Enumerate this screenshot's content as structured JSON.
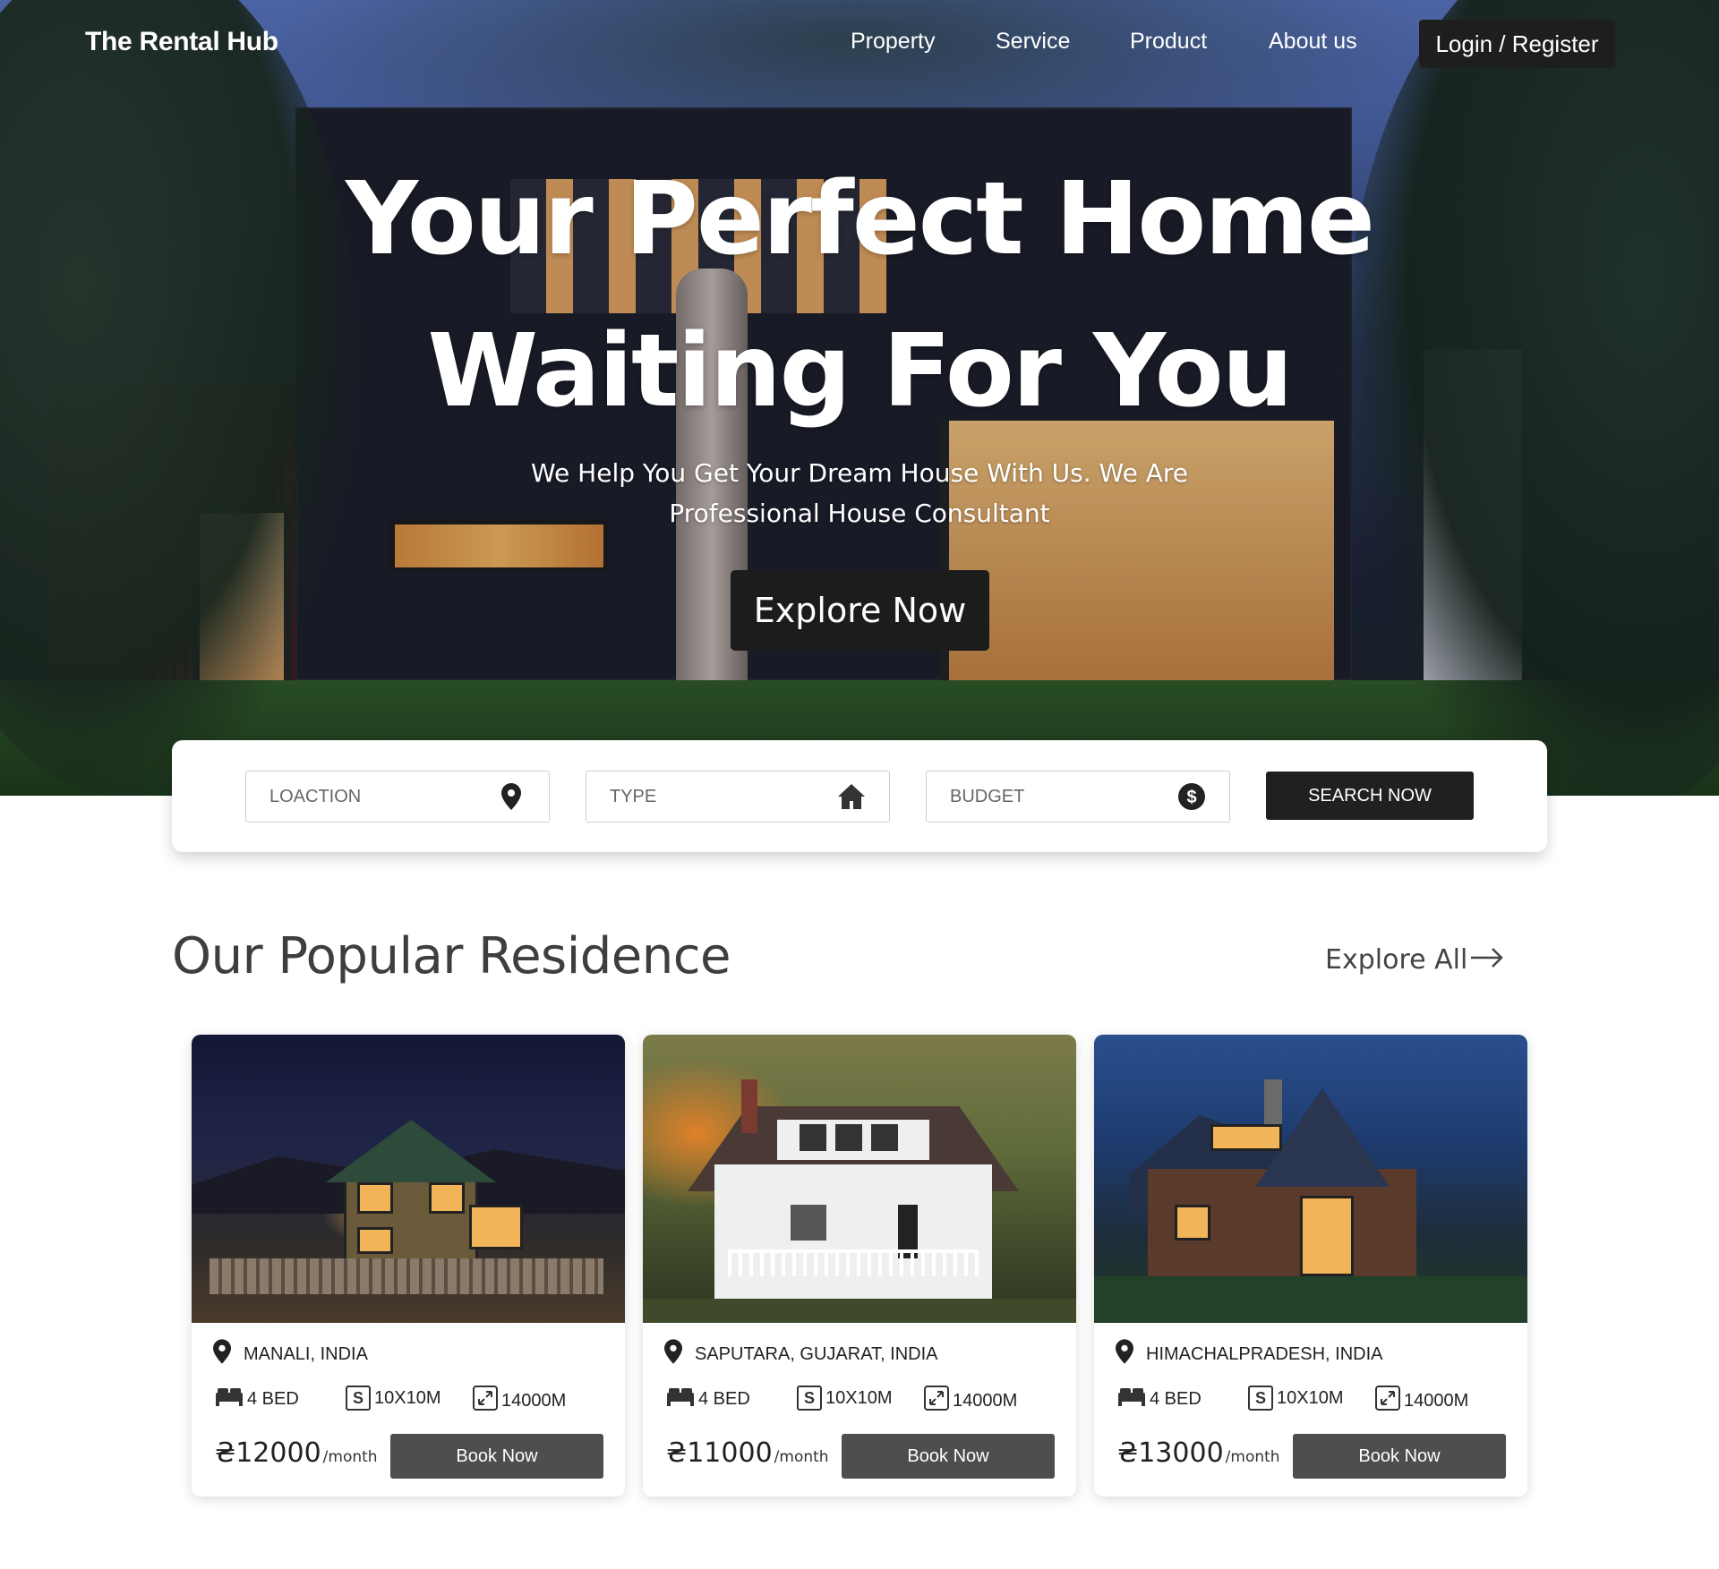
{
  "nav": {
    "brand": "The Rental Hub",
    "links": [
      "Property",
      "Service",
      "Product",
      "About us"
    ],
    "login_label": "Login / Register"
  },
  "hero": {
    "headline_line1": "Your Perfect Home",
    "headline_line2": "Waiting For You",
    "subline_line1": "We Help You Get Your Dream House With Us. We Are",
    "subline_line2": "Professional House Consultant",
    "cta_label": "Explore Now"
  },
  "search": {
    "location_placeholder": "LOACTION",
    "type_placeholder": "TYPE",
    "budget_placeholder": "BUDGET",
    "button_label": "SEARCH NOW",
    "icons": [
      "map-pin-icon",
      "home-icon",
      "dollar-icon"
    ]
  },
  "section": {
    "title": "Our Popular Residence",
    "explore_all_label": "Explore All"
  },
  "properties": [
    {
      "location": "MANALI, INDIA",
      "beds": "4 BED",
      "size": "10X10M",
      "area": "14000M",
      "price": "₴12000",
      "per": "/month",
      "book_label": "Book Now"
    },
    {
      "location": "SAPUTARA, GUJARAT, INDIA",
      "beds": "4 BED",
      "size": "10X10M",
      "area": "14000M",
      "price": "₴11000",
      "per": "/month",
      "book_label": "Book Now"
    },
    {
      "location": "HIMACHALPRADESH, INDIA",
      "beds": "4 BED",
      "size": "10X10M",
      "area": "14000M",
      "price": "₴13000",
      "per": "/month",
      "book_label": "Book Now"
    }
  ],
  "colors": {
    "dark_button": "#1e1e1e",
    "book_button": "#4e4e4e",
    "heading_gray": "#3e3e3e"
  }
}
